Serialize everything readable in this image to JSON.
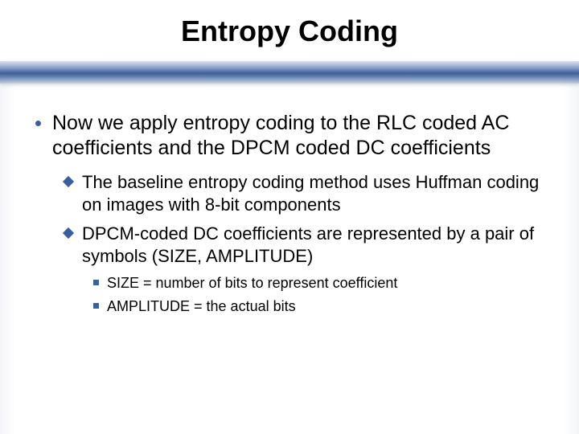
{
  "title": "Entropy Coding",
  "bullets": {
    "l1_0": "Now we apply entropy coding to the RLC coded AC coefficients and the DPCM coded DC coefficients",
    "l2_0": "The baseline entropy coding method uses Huffman coding on images with 8-bit components",
    "l2_1": "DPCM-coded DC coefficients are represented by a pair of symbols (SIZE, AMPLITUDE)",
    "l3_0": "SIZE = number of bits to represent coefficient",
    "l3_1": "AMPLITUDE = the actual bits"
  }
}
